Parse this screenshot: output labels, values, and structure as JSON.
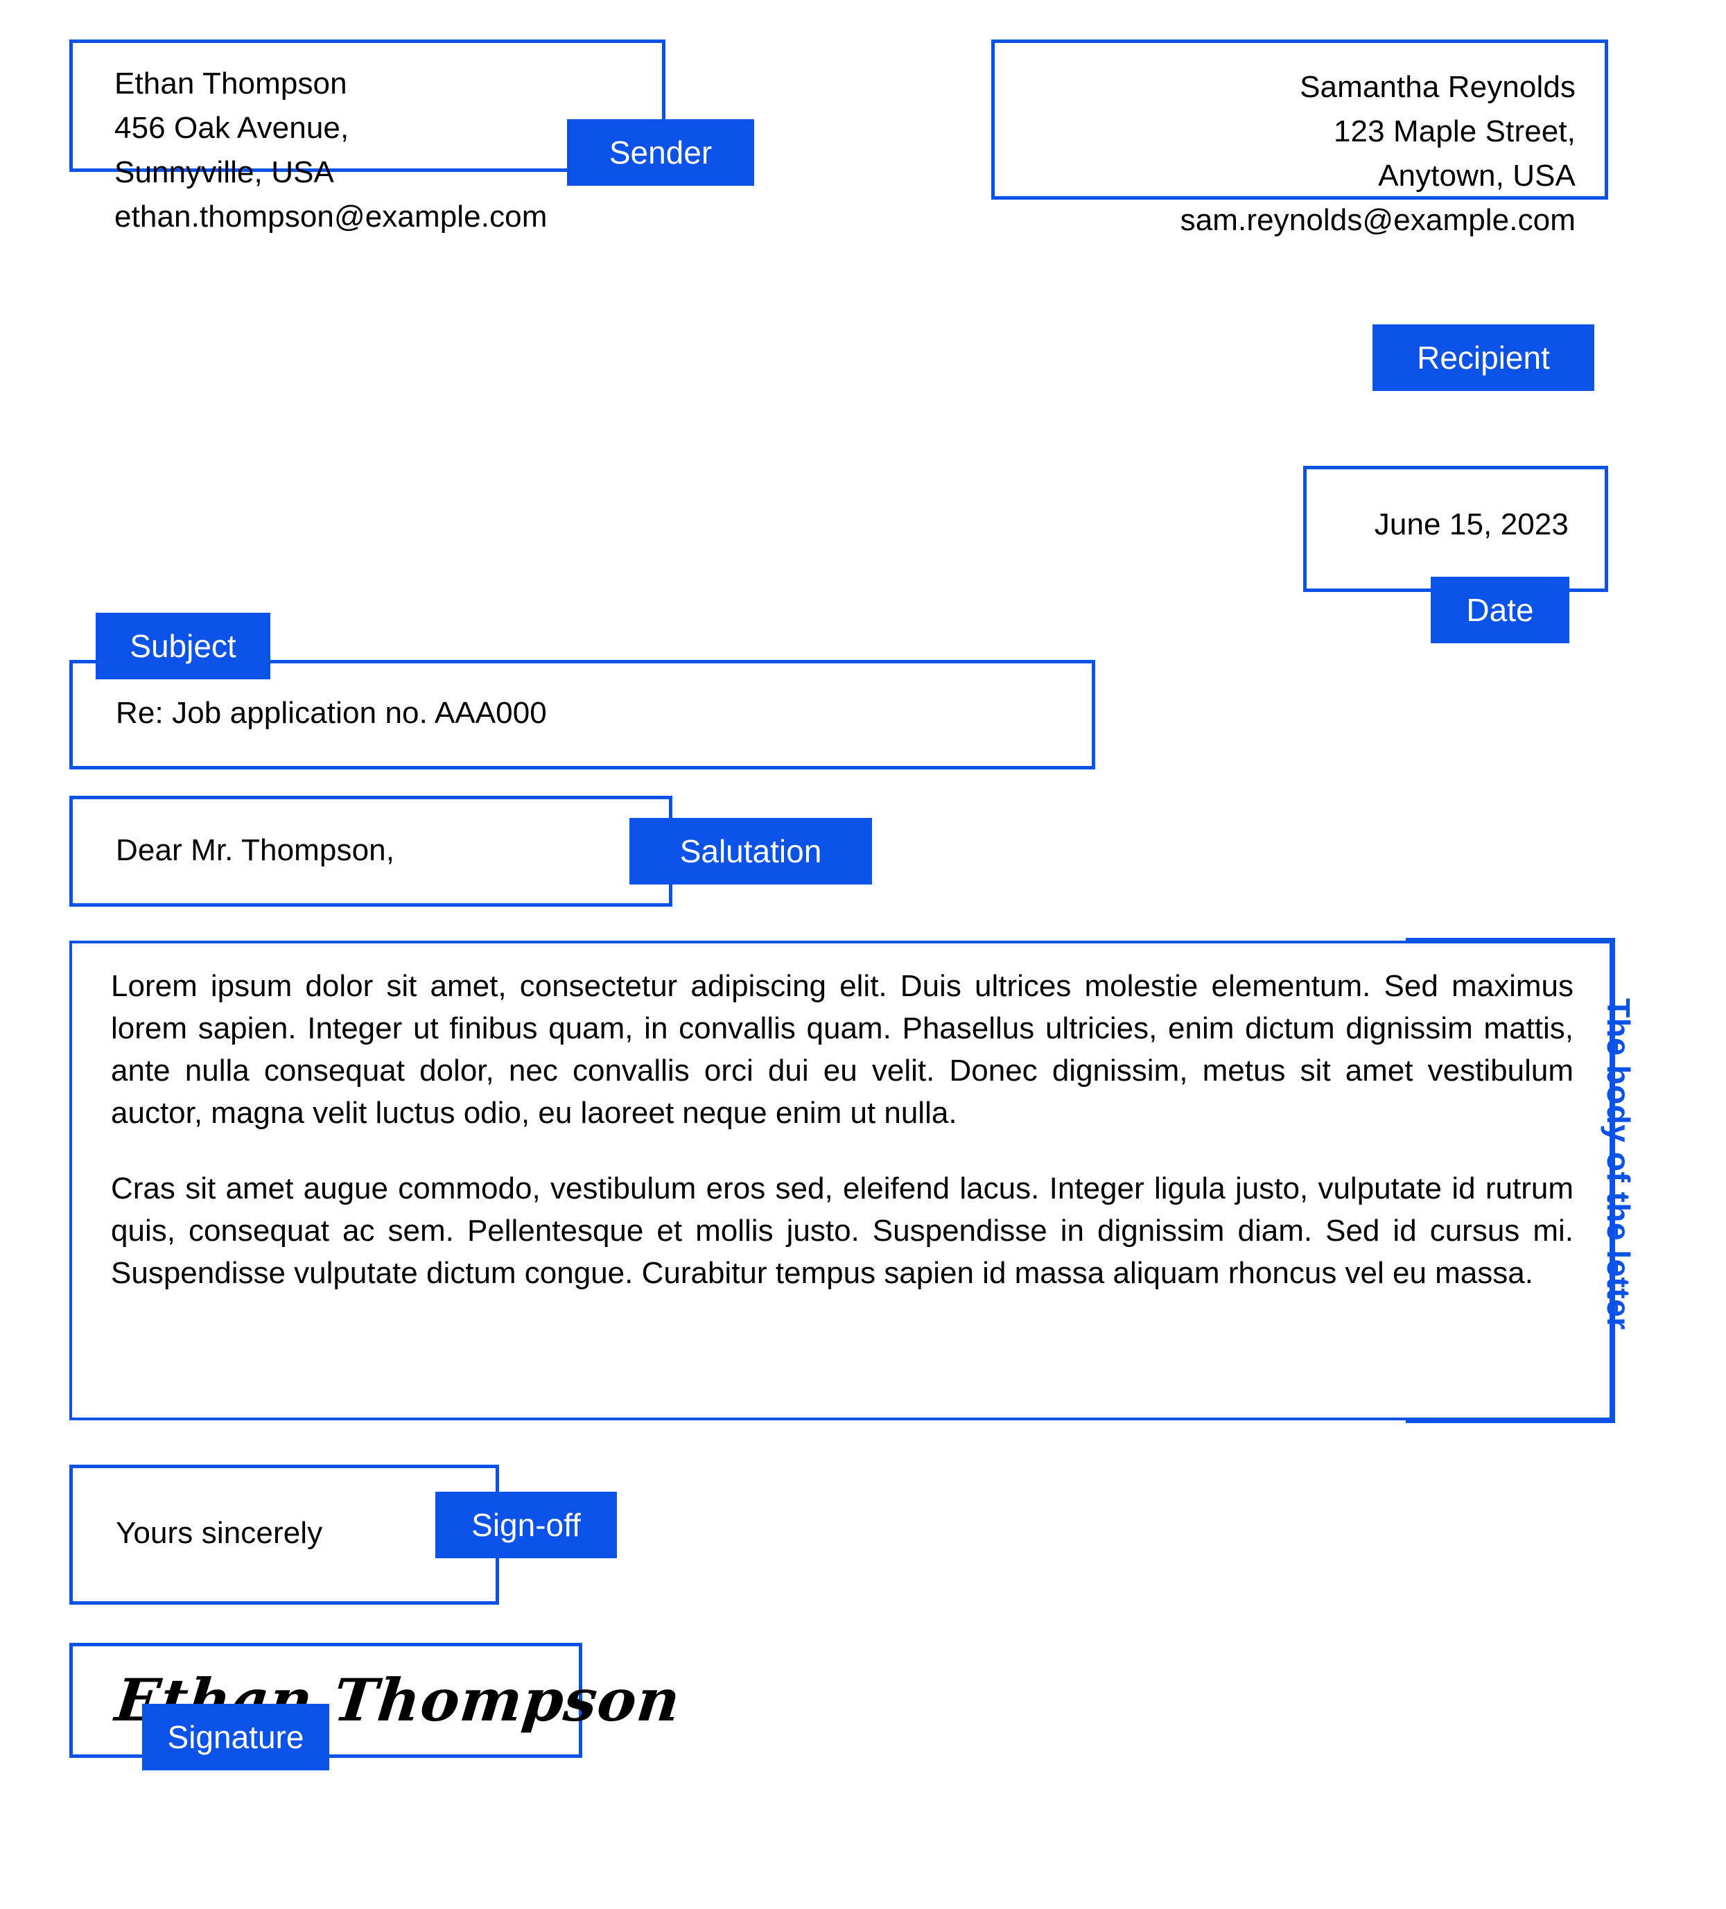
{
  "accent_color": "#0b52e8",
  "text_color": "#000000",
  "background_color": "#ffffff",
  "sender": {
    "tag": "Sender",
    "lines": "Ethan Thompson\n456 Oak Avenue,\nSunnyville, USA\nethan.thompson@example.com"
  },
  "recipient": {
    "tag": "Recipient",
    "lines": "Samantha Reynolds\n123 Maple Street,\nAnytown, USA\nsam.reynolds@example.com"
  },
  "date": {
    "tag": "Date",
    "value": "June 15, 2023"
  },
  "subject": {
    "tag": "Subject",
    "value": "Re: Job application no. AAA000"
  },
  "salutation": {
    "tag": "Salutation",
    "value": "Dear Mr. Thompson,"
  },
  "body": {
    "tag": "The body of the letter",
    "paragraph_1": "Lorem ipsum dolor sit amet, consectetur adipiscing elit. Duis ultrices molestie elementum. Sed maximus lorem sapien. Integer ut finibus quam, in convallis quam. Phasellus ultricies, enim dictum dignissim mattis, ante nulla consequat dolor, nec convallis orci dui eu velit. Donec dignissim, metus sit amet vestibulum auctor, magna velit luctus odio, eu laoreet neque enim ut nulla.",
    "paragraph_2": "Cras sit amet augue commodo, vestibulum eros sed, eleifend lacus. Integer ligula justo, vulputate id rutrum quis, consequat ac sem. Pellentesque et mollis justo. Suspendisse in dignissim diam. Sed id cursus mi. Suspendisse vulputate dictum congue. Curabitur tempus sapien id massa aliquam rhoncus vel eu massa."
  },
  "signoff": {
    "tag": "Sign-off",
    "value": "Yours sincerely"
  },
  "signature": {
    "tag": "Signature",
    "value": "Ethan Thompson"
  }
}
